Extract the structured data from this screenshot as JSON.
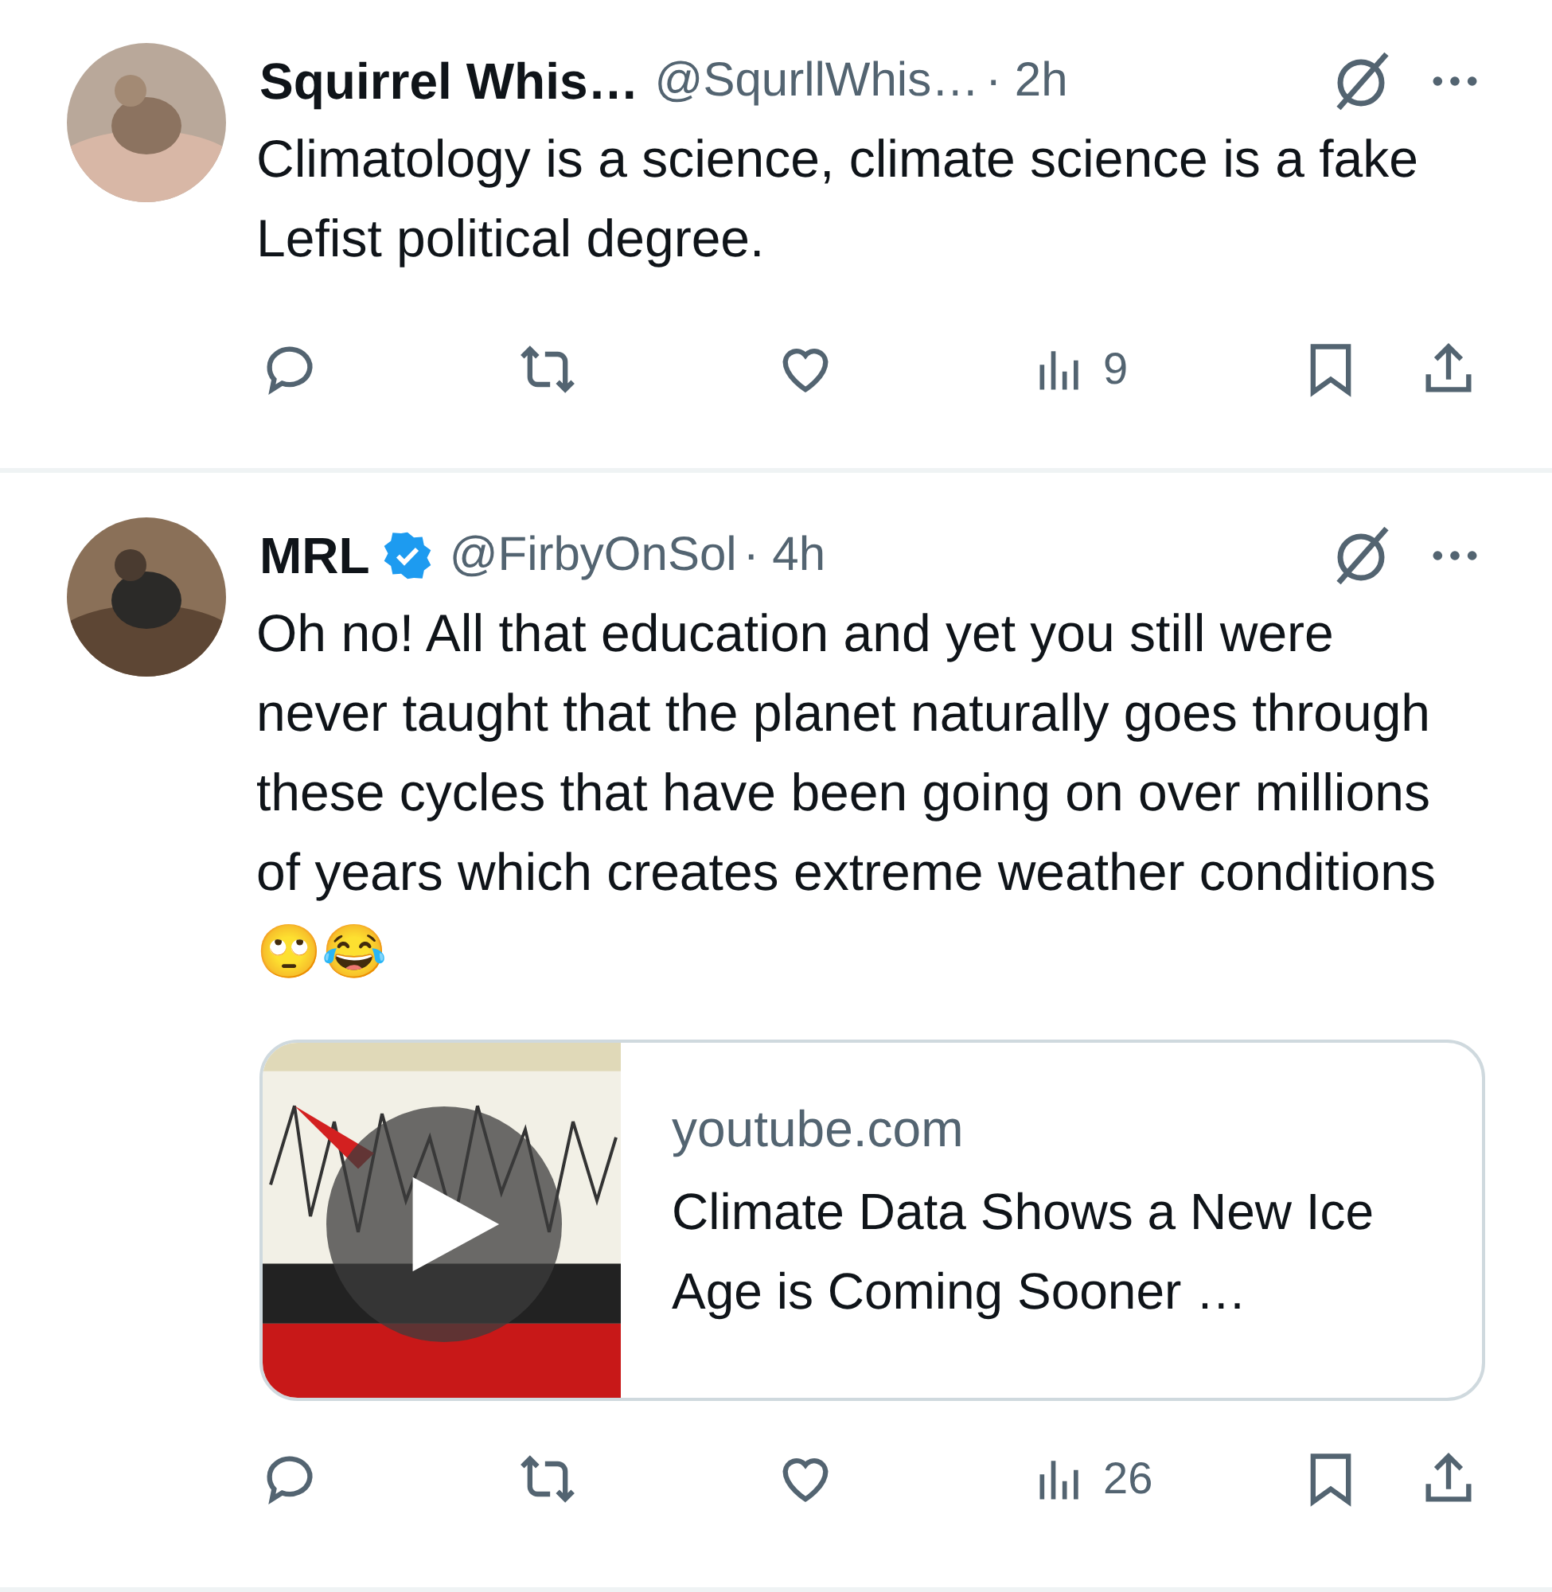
{
  "posts": [
    {
      "name": "Squirrel Whis…",
      "verified": false,
      "handle": "@SqurllWhis…",
      "time": "· 2h",
      "text": "Climatology is a science, climate science is a fake Lefist political degree.",
      "views": "9"
    },
    {
      "name": "MRL",
      "verified": true,
      "handle": "@FirbyOnSol",
      "time": "· 4h",
      "text": "Oh no! All that education and yet you still were never taught that the planet naturally goes through these cycles that have been going on over millions of years which creates extreme weather conditions 🙄😂",
      "views": "26",
      "card": {
        "domain": "youtube.com",
        "title": "Climate Data Shows a New Ice Age is Coming Sooner …",
        "kind": "picture"
      }
    }
  ]
}
